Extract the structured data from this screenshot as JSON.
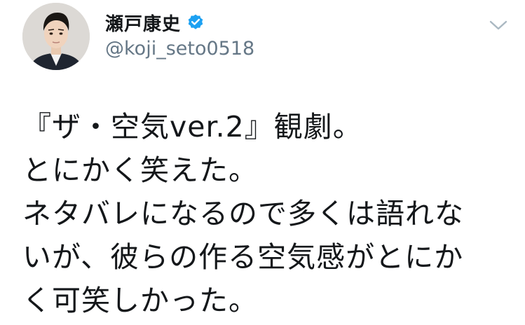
{
  "tweet": {
    "author": {
      "display_name": "瀬戸康史",
      "handle": "@koji_seto0518",
      "verified": true,
      "verified_icon": "verified-badge-icon",
      "avatar_icon": "user-avatar-photo"
    },
    "menu_icon": "chevron-down-icon",
    "text_lines": [
      "『ザ・空気ver.2』観劇。",
      "とにかく笑えた。",
      "ネタバレになるので多くは語れな",
      "いが、彼らの作る空気感がとにか",
      "く可笑しかった。"
    ]
  },
  "colors": {
    "verified_blue": "#1da1f2",
    "handle_gray": "#657786",
    "text": "#14171a",
    "chevron_gray": "#aab8c2"
  }
}
